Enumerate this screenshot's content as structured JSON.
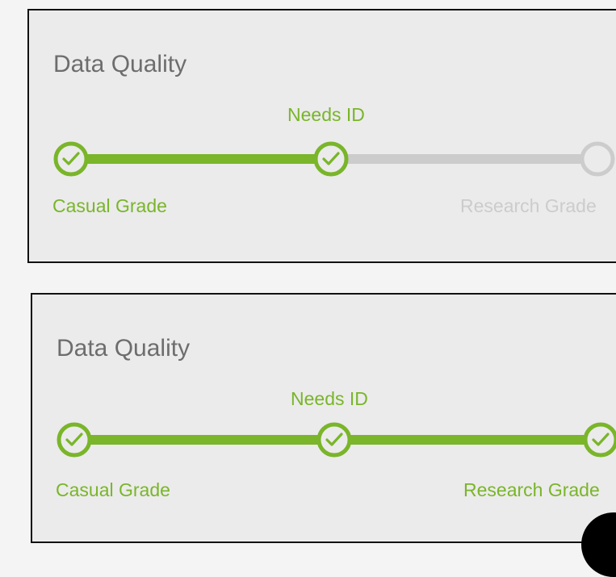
{
  "colors": {
    "complete": "#7ab52a",
    "incomplete": "#cccccc",
    "panel_bg": "#ebebeb",
    "title": "#6d6d6d"
  },
  "panels": [
    {
      "title": "Data Quality",
      "steps": [
        {
          "label": "Casual Grade",
          "state": "complete"
        },
        {
          "label": "Needs ID",
          "state": "complete"
        },
        {
          "label": "Research Grade",
          "state": "incomplete"
        }
      ]
    },
    {
      "title": "Data Quality",
      "steps": [
        {
          "label": "Casual Grade",
          "state": "complete"
        },
        {
          "label": "Needs ID",
          "state": "complete"
        },
        {
          "label": "Research Grade",
          "state": "complete"
        }
      ]
    }
  ]
}
